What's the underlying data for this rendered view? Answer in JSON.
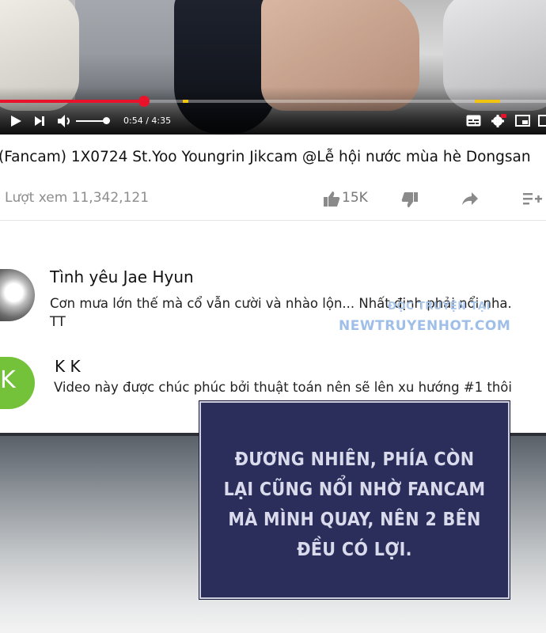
{
  "player": {
    "current_time": "0:54",
    "duration": "4:35",
    "time_display": "0:54 / 4:35",
    "progress_fraction": 0.264,
    "volume_fraction": 0.95,
    "colors": {
      "played": "#e8132b",
      "ad_marker": "#f2c40f"
    },
    "icons": [
      "play-icon",
      "next-icon",
      "volume-icon",
      "captions-icon",
      "settings-icon",
      "miniplayer-icon",
      "theater-icon"
    ]
  },
  "video": {
    "title": "(Fancam) 1X0724 St.Yoo Youngrin Jikcam @Lễ hội nước mùa hè Dongsan",
    "views": "Lượt xem 11,342,121",
    "likes": "15K",
    "icons": [
      "thumbs-up-icon",
      "thumbs-down-icon",
      "share-icon",
      "add-to-playlist-icon"
    ]
  },
  "comments": [
    {
      "author": "Tình yêu Jae Hyun",
      "text": "Cơn mưa lớn thế mà cổ vẫn cười và nhào lộn... Nhất định phải nổi nha. TT"
    },
    {
      "author": "K K",
      "avatar_letter": "K",
      "avatar_color": "#74c23a",
      "text": "Video này được chúc phúc bởi thuật toán nên sẽ lên xu hướng #1 thôi"
    }
  ],
  "watermark": {
    "small": "ĐỌC TRUYỆN TẠI",
    "main": "NEWTRUYENHOT.COM"
  },
  "narration": {
    "lines": [
      "ĐƯƠNG NHIÊN, PHÍA CÒN",
      "LẠI CŨNG NỔI NHỜ FANCAM",
      "MÀ MÌNH QUAY, NÊN 2 BÊN",
      "ĐỀU CÓ LỢI."
    ]
  }
}
